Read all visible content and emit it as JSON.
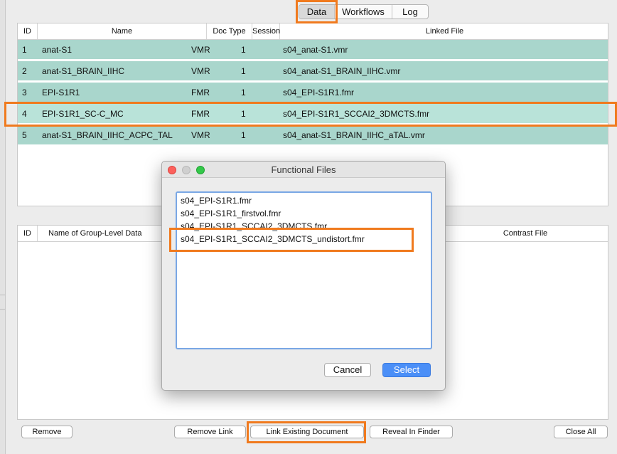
{
  "tabs": [
    {
      "label": "Data",
      "active": true
    },
    {
      "label": "Workflows",
      "active": false
    },
    {
      "label": "Log",
      "active": false
    }
  ],
  "documents_table": {
    "headers": {
      "id": "ID",
      "name": "Name",
      "doc_type": "Doc Type",
      "session": "Session",
      "linked_file": "Linked File"
    },
    "rows": [
      {
        "id": "1",
        "name": "anat-S1",
        "doc_type": "VMR",
        "session": "1",
        "linked_file": "s04_anat-S1.vmr"
      },
      {
        "id": "2",
        "name": "anat-S1_BRAIN_IIHC",
        "doc_type": "VMR",
        "session": "1",
        "linked_file": "s04_anat-S1_BRAIN_IIHC.vmr"
      },
      {
        "id": "3",
        "name": "EPI-S1R1",
        "doc_type": "FMR",
        "session": "1",
        "linked_file": "s04_EPI-S1R1.fmr"
      },
      {
        "id": "4",
        "name": "EPI-S1R1_SC-C_MC",
        "doc_type": "FMR",
        "session": "1",
        "linked_file": "s04_EPI-S1R1_SCCAI2_3DMCTS.fmr",
        "selected": true
      },
      {
        "id": "5",
        "name": "anat-S1_BRAIN_IIHC_ACPC_TAL",
        "doc_type": "VMR",
        "session": "1",
        "linked_file": "s04_anat-S1_BRAIN_IIHC_aTAL.vmr"
      }
    ]
  },
  "group_table": {
    "headers": {
      "id": "ID",
      "name": "Name of Group-Level Data",
      "contrast_file": "Contrast File"
    }
  },
  "buttons": {
    "remove": "Remove",
    "remove_link": "Remove Link",
    "link_existing": "Link Existing Document",
    "reveal": "Reveal In Finder",
    "close_all": "Close All"
  },
  "dialog": {
    "title": "Functional Files",
    "files": [
      "s04_EPI-S1R1.fmr",
      "s04_EPI-S1R1_firstvol.fmr",
      "s04_EPI-S1R1_SCCAI2_3DMCTS.fmr",
      "s04_EPI-S1R1_SCCAI2_3DMCTS_undistort.fmr"
    ],
    "cancel_label": "Cancel",
    "select_label": "Select"
  },
  "colors": {
    "row_fill": "#a9d6cc",
    "selected_row_fill": "#b9e3d9",
    "highlight": "#f07a1e",
    "primary_button": "#4b8ff7"
  }
}
